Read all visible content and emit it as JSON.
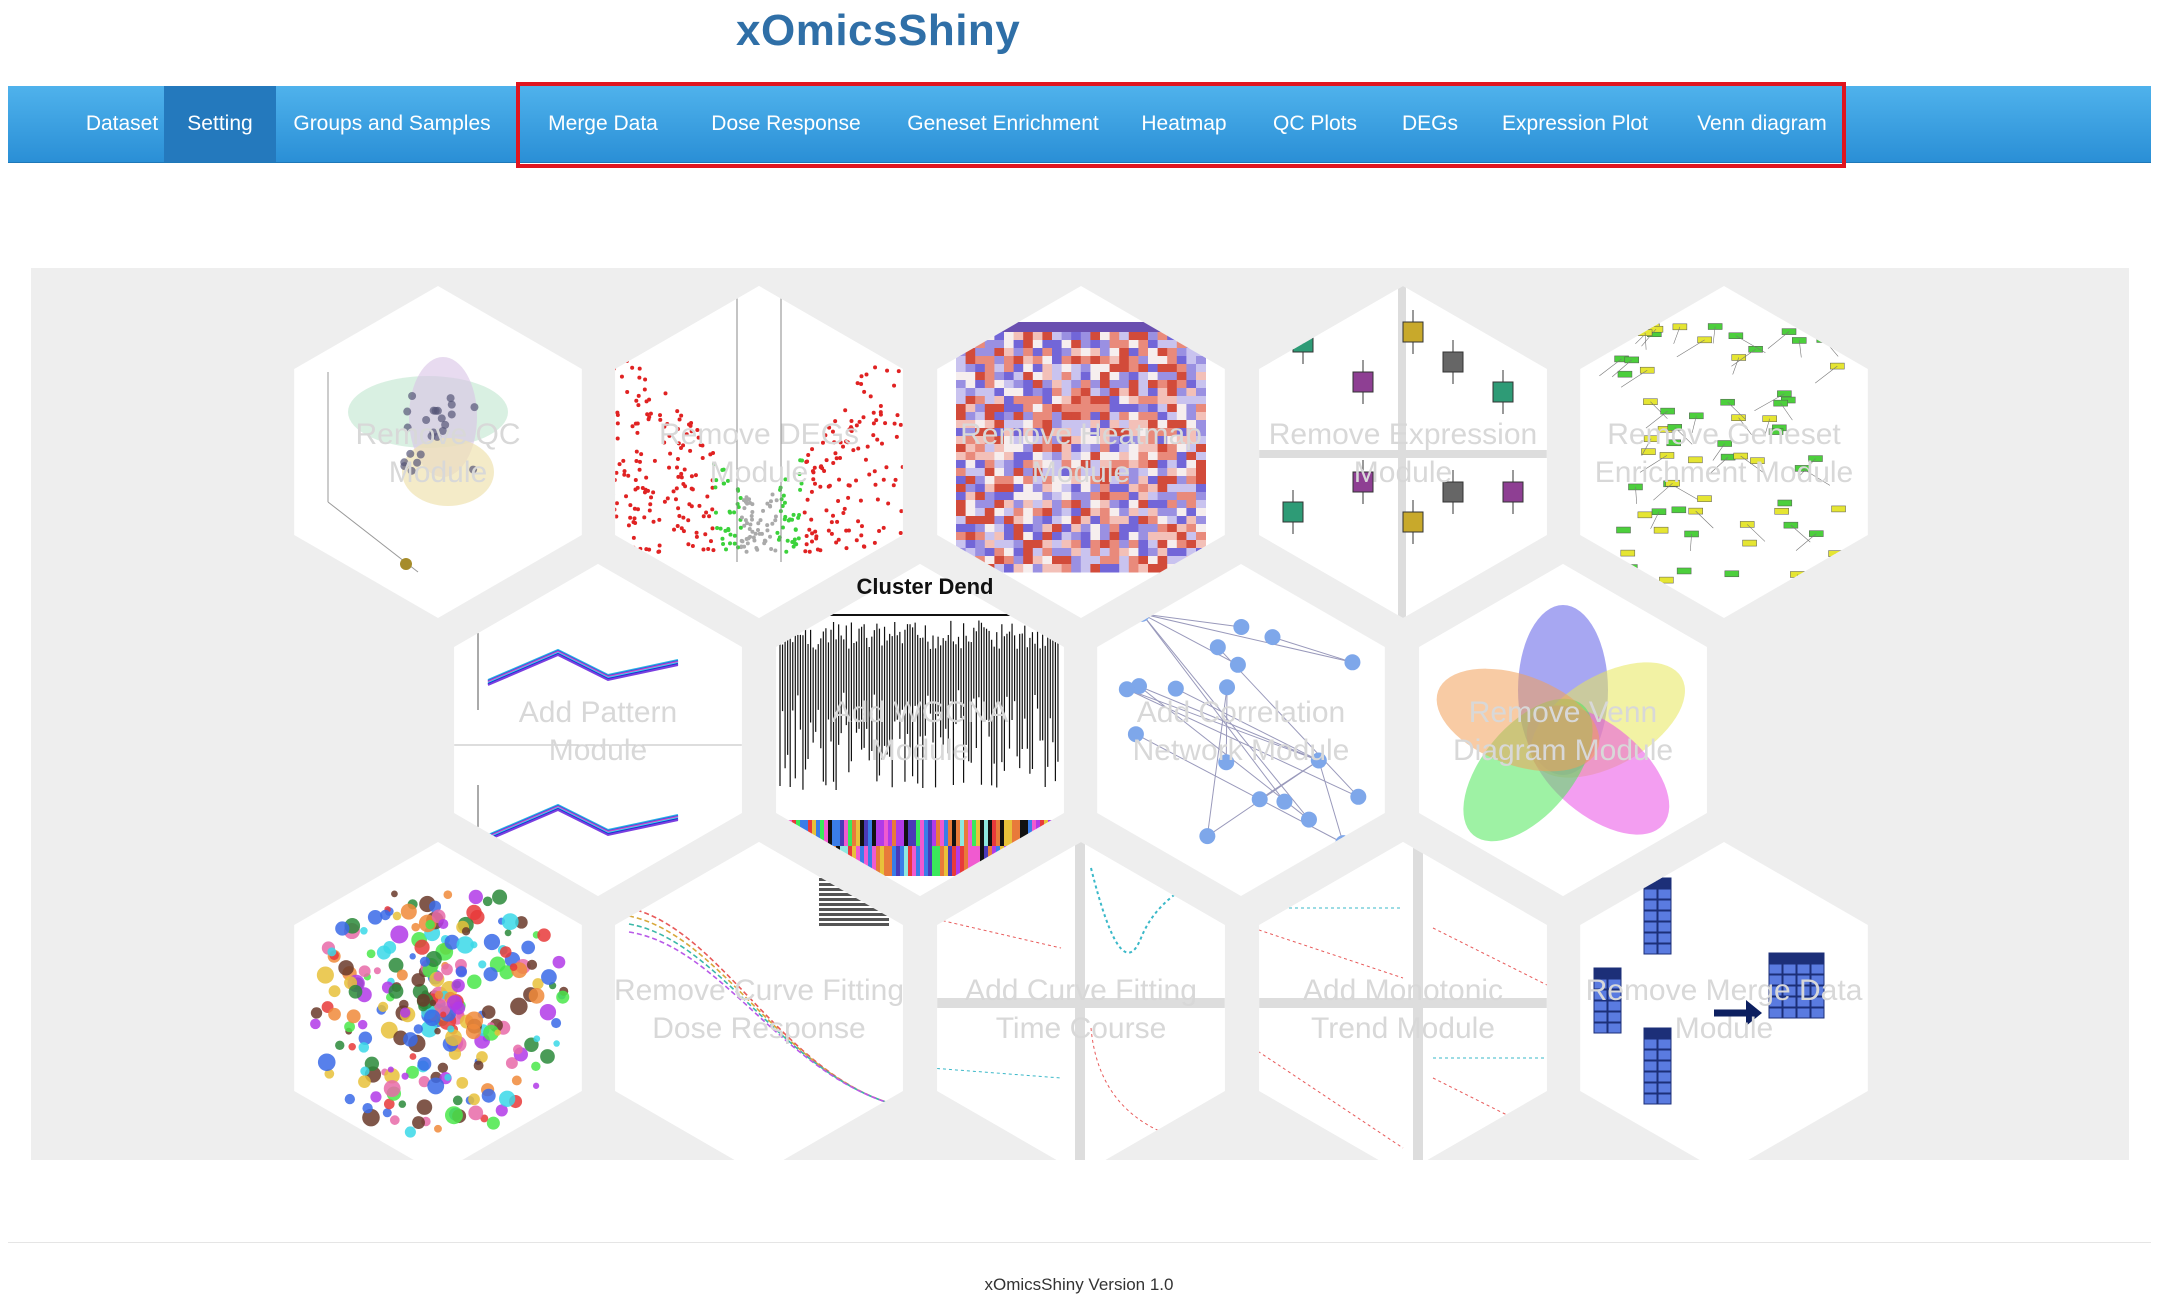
{
  "app": {
    "title": "xOmicsShiny"
  },
  "nav": {
    "active_index": 1,
    "items": [
      {
        "label": "Dataset",
        "name": "nav-dataset"
      },
      {
        "label": "Setting",
        "name": "nav-setting"
      },
      {
        "label": "Groups and Samples",
        "name": "nav-groups-and-samples"
      },
      {
        "label": "Merge Data",
        "name": "nav-merge-data"
      },
      {
        "label": "Dose Response",
        "name": "nav-dose-response"
      },
      {
        "label": "Geneset Enrichment",
        "name": "nav-geneset-enrichment"
      },
      {
        "label": "Heatmap",
        "name": "nav-heatmap"
      },
      {
        "label": "QC Plots",
        "name": "nav-qc-plots"
      },
      {
        "label": "DEGs",
        "name": "nav-degs"
      },
      {
        "label": "Expression Plot",
        "name": "nav-expression-plot"
      },
      {
        "label": "Venn diagram",
        "name": "nav-venn-diagram"
      }
    ]
  },
  "highlight_color": "#e0151f",
  "modules": [
    {
      "lines": [
        "Remove QC",
        "Module"
      ],
      "thumb": "pca-3d",
      "name": "module-qc"
    },
    {
      "lines": [
        "Remove DEGs",
        "Module"
      ],
      "thumb": "volcano",
      "name": "module-degs"
    },
    {
      "lines": [
        "Remove Heatmap",
        "Module"
      ],
      "thumb": "heatmap",
      "name": "module-heatmap"
    },
    {
      "lines": [
        "Remove Expression",
        "Module"
      ],
      "thumb": "boxplot",
      "name": "module-expression"
    },
    {
      "lines": [
        "Remove Geneset",
        "Enrichment Module"
      ],
      "thumb": "pathway",
      "name": "module-geneset"
    },
    {
      "lines": [
        "Add Pattern",
        "Module"
      ],
      "thumb": "pattern",
      "name": "module-pattern"
    },
    {
      "lines": [
        "Add WGCNA",
        "Module"
      ],
      "thumb": "dendrogram",
      "title": "Cluster Dend",
      "name": "module-wgcna"
    },
    {
      "lines": [
        "Add Correlation",
        "Network Module"
      ],
      "thumb": "network",
      "name": "module-correlation-network"
    },
    {
      "lines": [
        "Remove Venn",
        "Diagram Module"
      ],
      "thumb": "venn",
      "name": "module-venn"
    },
    {
      "lines": [
        "",
        ""
      ],
      "thumb": "bignet",
      "name": "module-pathway-network"
    },
    {
      "lines": [
        "Remove Curve Fitting",
        "Dose Response"
      ],
      "thumb": "dosecurve",
      "name": "module-curve-fitting-dose"
    },
    {
      "lines": [
        "Add Curve Fitting",
        "Time Course"
      ],
      "thumb": "timecourse",
      "name": "module-curve-fitting-time"
    },
    {
      "lines": [
        "Add Monotonic",
        "Trend Module"
      ],
      "thumb": "trend",
      "name": "module-monotonic-trend"
    },
    {
      "lines": [
        "Remove Merge Data",
        "Module"
      ],
      "thumb": "merge",
      "name": "module-merge-data"
    }
  ],
  "footer": {
    "version": "xOmicsShiny Version 1.0"
  }
}
